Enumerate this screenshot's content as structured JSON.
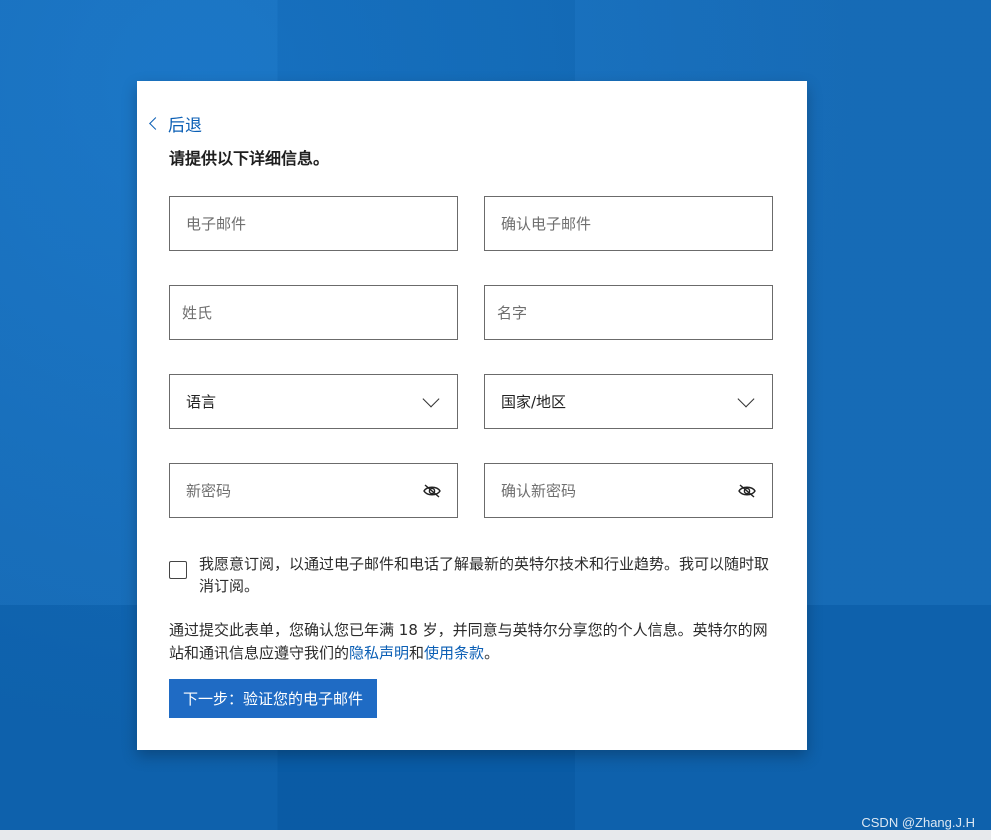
{
  "back": {
    "label": "后退"
  },
  "heading": "请提供以下详细信息。",
  "fields": {
    "email": {
      "placeholder": "电子邮件"
    },
    "confirm_email": {
      "placeholder": "确认电子邮件"
    },
    "last_name": {
      "placeholder": "姓氏"
    },
    "first_name": {
      "placeholder": "名字"
    },
    "language": {
      "label": "语言"
    },
    "country": {
      "label": "国家/地区"
    },
    "password": {
      "placeholder": "新密码"
    },
    "confirm_password": {
      "placeholder": "确认新密码"
    }
  },
  "consent": {
    "text": "我愿意订阅，以通过电子邮件和电话了解最新的英特尔技术和行业趋势。我可以随时取消订阅。",
    "checked": false
  },
  "legal": {
    "prefix": "通过提交此表单，您确认您已年满 18 岁，并同意与英特尔分享您的个人信息。英特尔的网站和通讯信息应遵守我们的",
    "privacy_link": "隐私声明",
    "and": "和",
    "terms_link": "使用条款",
    "suffix": "。"
  },
  "next_button": {
    "label": "下一步：验证您的电子邮件"
  },
  "watermark": "CSDN @Zhang.J.H",
  "colors": {
    "background": "#0a63b3",
    "link": "#0b5fb5",
    "button": "#1f6bc4"
  },
  "icons": {
    "back": "chevron-left-icon",
    "dropdown": "chevron-down-icon",
    "password_toggle": "eye-slash-icon"
  }
}
